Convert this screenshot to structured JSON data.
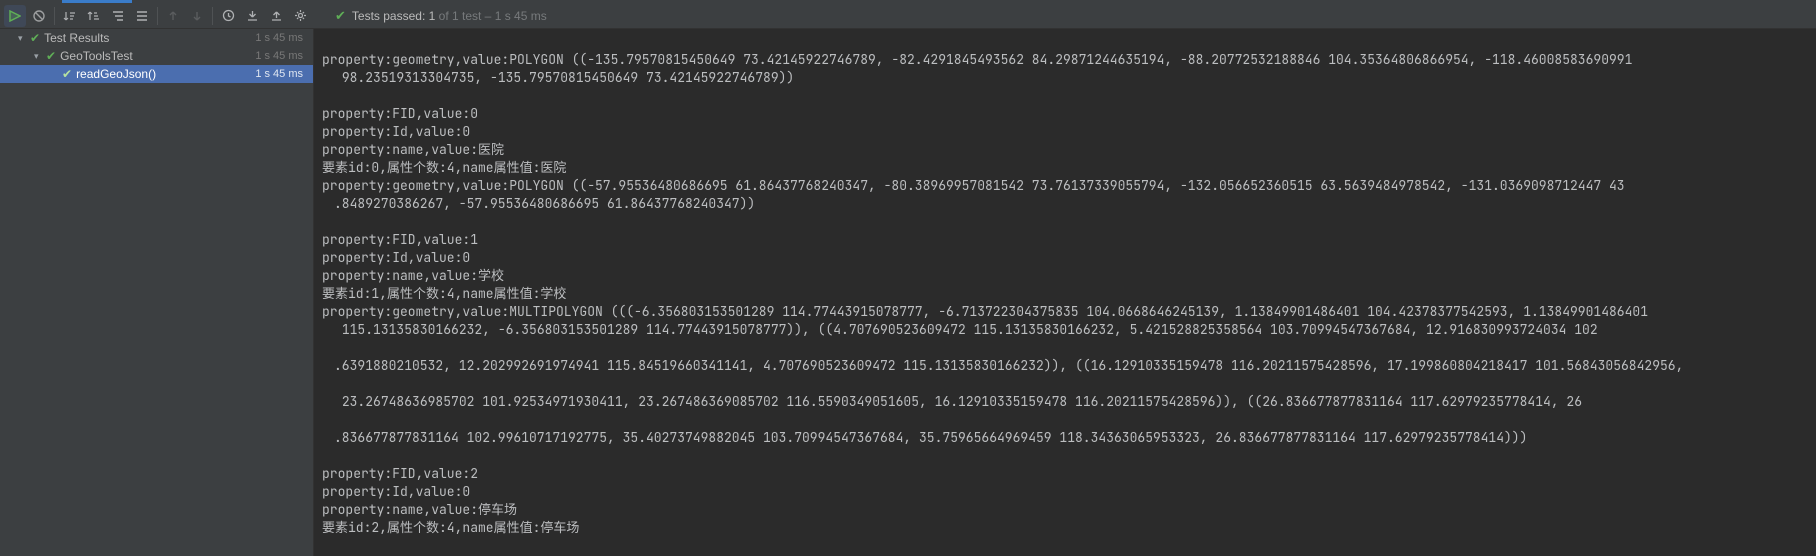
{
  "toolbar": {
    "status_prefix": "Tests passed:",
    "status_count": "1",
    "status_mid": "of 1 test –",
    "status_time": "1 s 45 ms"
  },
  "tree": {
    "root": {
      "label": "Test Results",
      "time": "1 s 45 ms"
    },
    "class": {
      "label": "GeoToolsTest",
      "time": "1 s 45 ms"
    },
    "method": {
      "label": "readGeoJson()",
      "time": "1 s 45 ms"
    }
  },
  "console": {
    "l01": "property:geometry,value:POLYGON ((-135.79570815450649 73.42145922746789, -82.4291845493562 84.29871244635194, -88.20772532188846 104.35364806866954, -118.46008583690991",
    "l01b": " 98.23519313304735, -135.79570815450649 73.42145922746789))",
    "l02": "property:FID,value:0",
    "l03": "property:Id,value:0",
    "l04": "property:name,value:医院",
    "l05": "要素id:0,属性个数:4,name属性值:医院",
    "l06": "property:geometry,value:POLYGON ((-57.95536480686695 61.86437768240347, -80.38969957081542 73.76137339055794, -132.056652360515 63.5639484978542, -131.0369098712447 43",
    "l06b": ".8489270386267, -57.95536480686695 61.86437768240347))",
    "l07": "property:FID,value:1",
    "l08": "property:Id,value:0",
    "l09": "property:name,value:学校",
    "l10": "要素id:1,属性个数:4,name属性值:学校",
    "l11": "property:geometry,value:MULTIPOLYGON (((-6.356803153501289 114.77443915078777, -6.713722304375835 104.0668646245139, 1.13849901486401 104.42378377542593, 1.13849901486401",
    "l11b": " 115.13135830166232, -6.356803153501289 114.77443915078777)), ((4.707690523609472 115.13135830166232, 5.421528825358564 103.70994547367684, 12.916830993724034 102",
    "l11c": ".6391880210532, 12.202992691974941 115.84519660341141, 4.707690523609472 115.13135830166232)), ((16.12910335159478 116.20211575428596, 17.199860804218417 101.56843056842956,",
    "l11d": " 23.26748636985702 101.92534971930411, 23.267486369085702 116.5590349051605, 16.12910335159478 116.20211575428596)), ((26.836677877831164 117.62979235778414, 26",
    "l11e": ".836677877831164 102.99610717192775, 35.40273749882045 103.70994547367684, 35.75965664969459 118.34363065953323, 26.836677877831164 117.62979235778414)))",
    "l12": "property:FID,value:2",
    "l13": "property:Id,value:0",
    "l14": "property:name,value:停车场",
    "l15": "要素id:2,属性个数:4,name属性值:停车场"
  }
}
